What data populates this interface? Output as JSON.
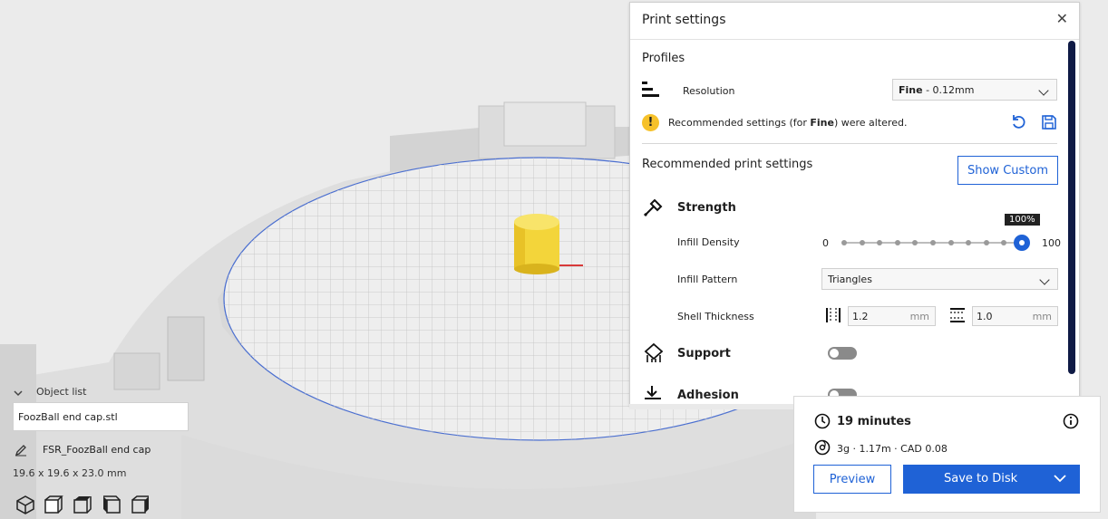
{
  "panel": {
    "title": "Print settings",
    "close_glyph": "✕",
    "profiles_heading": "Profiles",
    "resolution_label": "Resolution",
    "resolution_value_bold": "Fine",
    "resolution_value_rest": " - 0.12mm",
    "warning_icon_glyph": "!",
    "warning_pre": "Recommended settings (for ",
    "warning_bold": "Fine",
    "warning_post": ") were altered.",
    "recommended_heading": "Recommended print settings",
    "show_custom_label": "Show Custom",
    "strength_heading": "Strength",
    "infill_density_label": "Infill Density",
    "slider_min": "0",
    "slider_max": "100",
    "slider_tooltip": "100%",
    "slider_value": 100,
    "infill_pattern_label": "Infill Pattern",
    "infill_pattern_value": "Triangles",
    "shell_thickness_label": "Shell Thickness",
    "wall_value": "1.2",
    "wall_unit": "mm",
    "topbottom_value": "1.0",
    "topbottom_unit": "mm",
    "support_heading": "Support",
    "support_enabled": false,
    "adhesion_heading": "Adhesion",
    "adhesion_enabled": false
  },
  "estimate": {
    "time": "19 minutes",
    "material": "3g · 1.17m · CAD 0.08",
    "preview_label": "Preview",
    "save_label": "Save to Disk"
  },
  "objects": {
    "header": "Object list",
    "file_name": "FoozBall end cap.stl",
    "object_name": "FSR_FoozBall end cap",
    "dimensions": "19.6 x 19.6 x 23.0 mm"
  },
  "colors": {
    "accent": "#1f62d6",
    "object": "#f6e04a",
    "warning": "#f6c12a",
    "scrollbar": "#0f1a45"
  }
}
